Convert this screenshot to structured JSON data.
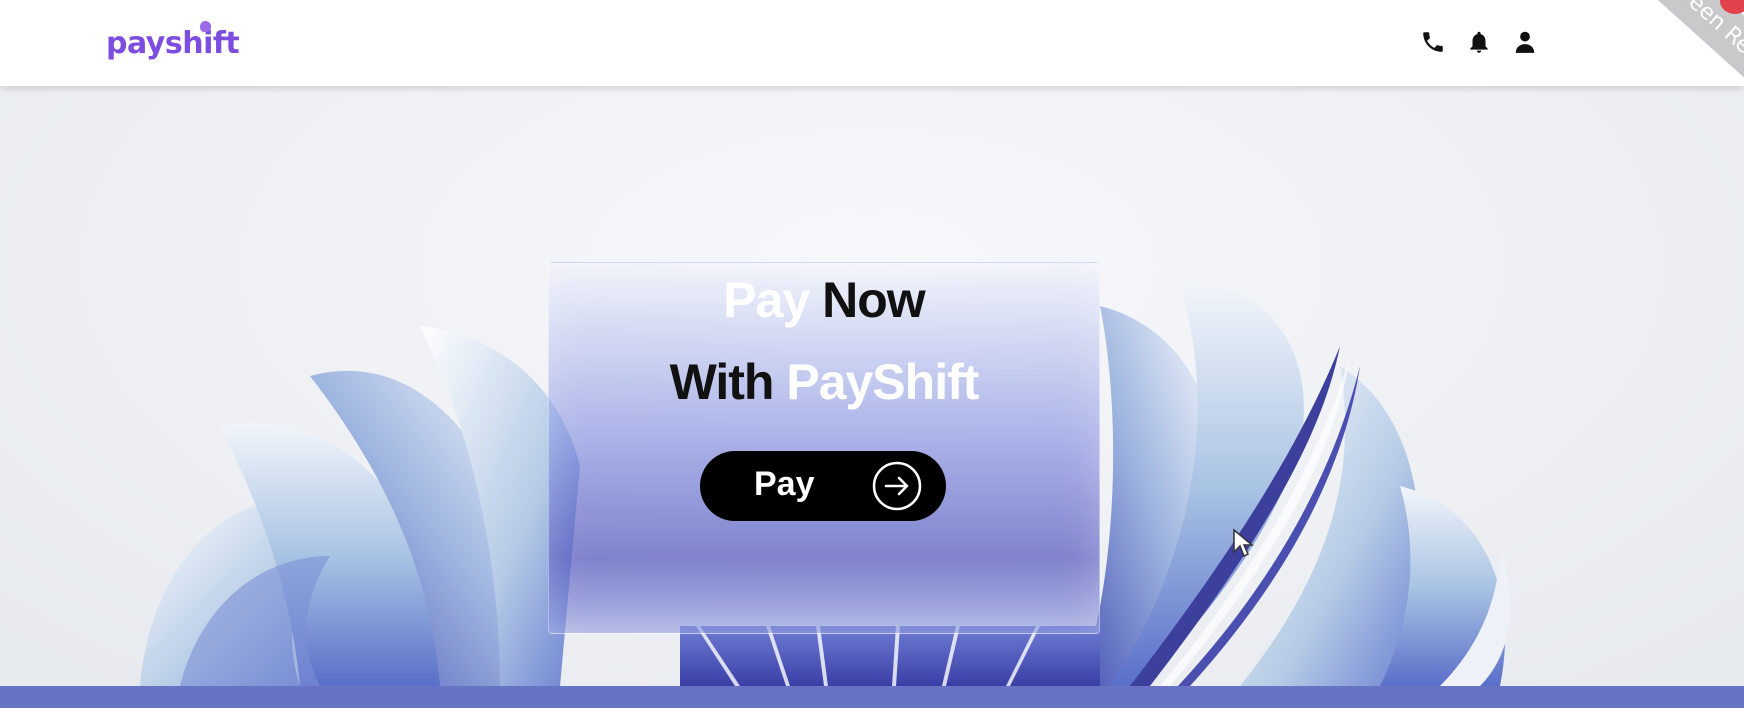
{
  "header": {
    "logo_text": "payshift",
    "icons": [
      "phone-icon",
      "bell-icon",
      "user-icon"
    ]
  },
  "ribbon": {
    "text": "Screen Reco"
  },
  "hero": {
    "line1_a": "Pay",
    "line1_b": "Now",
    "line2_a": "With",
    "line2_b": "PayShift",
    "button_label": "Pay"
  },
  "colors": {
    "brand": "#7c4dde",
    "button": "#000000",
    "band": "#6774c4",
    "text_dark": "#111111",
    "text_light": "#ffffff"
  }
}
